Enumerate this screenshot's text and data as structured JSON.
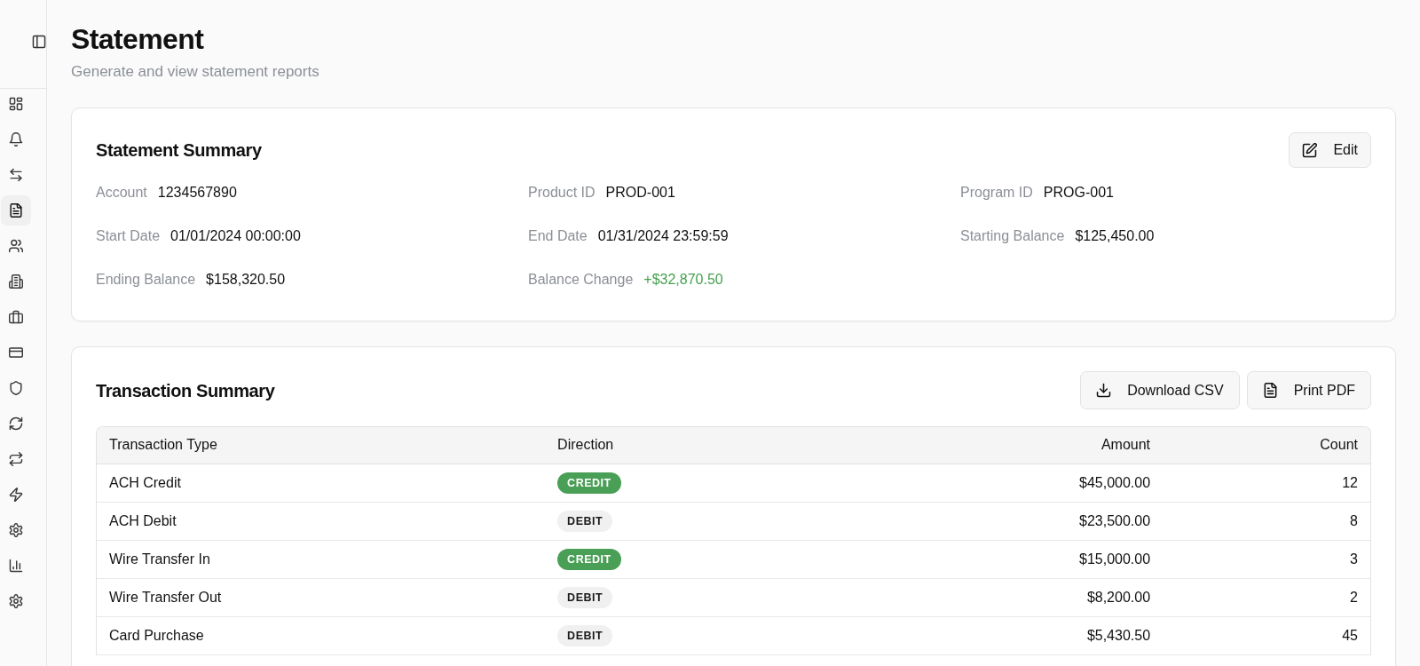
{
  "page": {
    "title": "Statement",
    "subtitle": "Generate and view statement reports"
  },
  "sidebar": {
    "items": [
      {
        "selected": false
      },
      {
        "selected": false
      },
      {
        "selected": false
      },
      {
        "selected": true
      },
      {
        "selected": false
      },
      {
        "selected": false
      },
      {
        "selected": false
      },
      {
        "selected": false
      },
      {
        "selected": false
      },
      {
        "selected": false
      },
      {
        "selected": false
      },
      {
        "selected": false
      },
      {
        "selected": false
      },
      {
        "selected": false
      },
      {
        "selected": false
      }
    ]
  },
  "statement_summary": {
    "title": "Statement Summary",
    "edit_button": "Edit",
    "fields": [
      {
        "label": "Account",
        "value": "1234567890",
        "positive": false
      },
      {
        "label": "Product ID",
        "value": "PROD-001",
        "positive": false
      },
      {
        "label": "Program ID",
        "value": "PROG-001",
        "positive": false
      },
      {
        "label": "Start Date",
        "value": "01/01/2024 00:00:00",
        "positive": false
      },
      {
        "label": "End Date",
        "value": "01/31/2024 23:59:59",
        "positive": false
      },
      {
        "label": "Starting Balance",
        "value": "$125,450.00",
        "positive": false
      },
      {
        "label": "Ending Balance",
        "value": "$158,320.50",
        "positive": false
      },
      {
        "label": "Balance Change",
        "value": "+$32,870.50",
        "positive": true
      }
    ]
  },
  "transaction_summary": {
    "title": "Transaction Summary",
    "buttons": [
      {
        "label": "Download CSV",
        "kind": "download"
      },
      {
        "label": "Print PDF",
        "kind": "print"
      }
    ],
    "table": {
      "columns": [
        "Transaction Type",
        "Direction",
        "Amount",
        "Count"
      ],
      "rows": [
        {
          "type": "ACH Credit",
          "direction": {
            "label": "CREDIT",
            "kind": "credit"
          },
          "amount": "$45,000.00",
          "count": "12"
        },
        {
          "type": "ACH Debit",
          "direction": {
            "label": "DEBIT",
            "kind": "debit"
          },
          "amount": "$23,500.00",
          "count": "8"
        },
        {
          "type": "Wire Transfer In",
          "direction": {
            "label": "CREDIT",
            "kind": "credit"
          },
          "amount": "$15,000.00",
          "count": "3"
        },
        {
          "type": "Wire Transfer Out",
          "direction": {
            "label": "DEBIT",
            "kind": "debit"
          },
          "amount": "$8,200.00",
          "count": "2"
        },
        {
          "type": "Card Purchase",
          "direction": {
            "label": "DEBIT",
            "kind": "debit"
          },
          "amount": "$5,430.50",
          "count": "45"
        }
      ]
    }
  }
}
